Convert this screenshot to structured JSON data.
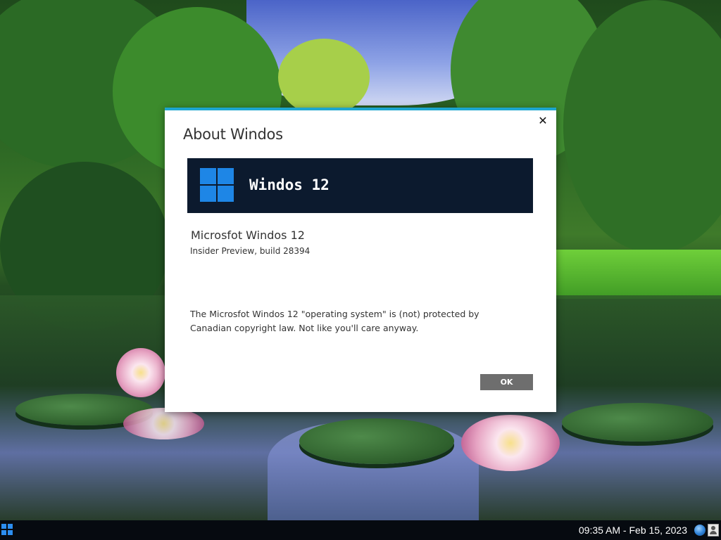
{
  "dialog": {
    "title": "About Windos",
    "close_glyph": "✕",
    "banner_title": "Windos 12",
    "product_name": "Microsfot Windos 12",
    "build_info": "Insider Preview, build 28394",
    "legal_text": "The Microsfot Windos 12 \"operating system\" is (not) protected by Canadian copyright law. Not like you'll care anyway.",
    "ok_label": "OK",
    "accent_color": "#1ca6cf",
    "banner_color": "#0c1a2e",
    "logo_color": "#1e86e6"
  },
  "taskbar": {
    "clock": "09:35 AM - Feb 15, 2023",
    "icons": [
      "start-icon",
      "globe-icon",
      "user-icon"
    ]
  }
}
